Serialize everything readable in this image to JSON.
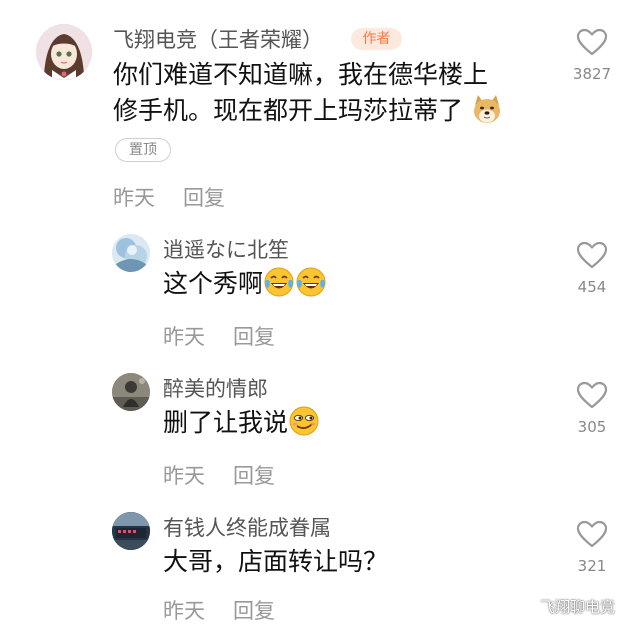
{
  "main_comment": {
    "username": "飞翔电竞（王者荣耀）",
    "author_badge": "作者",
    "text_line1": "你们难道不知道嘛，我在德华楼上",
    "text_line2": "修手机。现在都开上玛莎拉蒂了",
    "pinned_label": "置顶",
    "time": "昨天",
    "reply_label": "回复",
    "like_count": "3827",
    "emoji": "doge-emoji"
  },
  "replies": [
    {
      "username": "逍遥なに北笙",
      "text": "这个秀啊",
      "time": "昨天",
      "reply_label": "回复",
      "like_count": "454",
      "emoji": "laugh-tears-emoji"
    },
    {
      "username": "醉美的情郎",
      "text": "删了让我说",
      "time": "昨天",
      "reply_label": "回复",
      "like_count": "305",
      "emoji": "smirk-emoji"
    },
    {
      "username": "有钱人终能成眷属",
      "text": "大哥，店面转让吗？",
      "time": "昨天",
      "reply_label": "回复",
      "like_count": "321"
    }
  ],
  "watermark": "飞翔聊电竞",
  "colors": {
    "author_badge_bg": "#fde9de",
    "author_badge_text": "#ff7a3d",
    "username": "#555555",
    "meta": "#999999",
    "body_text": "#111111"
  },
  "icons": [
    "heart-outline-icon"
  ]
}
